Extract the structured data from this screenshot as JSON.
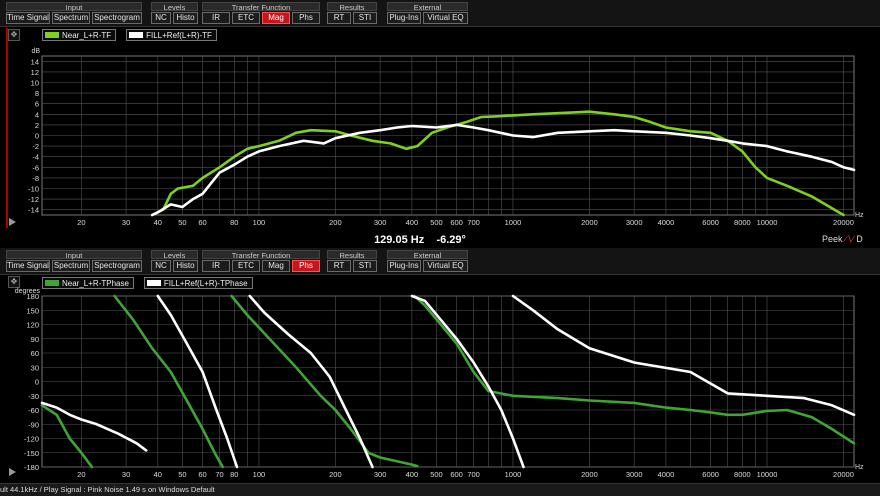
{
  "toolbar": {
    "groups": [
      {
        "title": "Input",
        "buttons": [
          "Time Signal",
          "Spectrum",
          "Spectrogram"
        ]
      },
      {
        "title": "Levels",
        "buttons": [
          "NC",
          "Histo"
        ]
      },
      {
        "title": "Transfer Function",
        "buttons": [
          "IR",
          "ETC",
          "Mag",
          "Phs"
        ]
      },
      {
        "title": "Results",
        "buttons": [
          "RT",
          "STI"
        ]
      },
      {
        "title": "External",
        "buttons": [
          "Plug-Ins",
          "Virtual EQ"
        ]
      }
    ],
    "top_active": "Mag",
    "bottom_active": "Phs"
  },
  "top_panel": {
    "legend": [
      {
        "label": "Near_L+R-TF",
        "color": "#7fd11b"
      },
      {
        "label": "FILL+Ref(L+R)-TF",
        "color": "#ffffff"
      }
    ]
  },
  "bottom_panel": {
    "legend": [
      {
        "label": "Near_L+R-TPhase",
        "color": "#3fa535"
      },
      {
        "label": "FILL+Ref(L+R)-TPhase",
        "color": "#ffffff"
      }
    ]
  },
  "readout": {
    "freq": "129.05 Hz",
    "value": "-6.29°"
  },
  "peek_label": "Peek",
  "peek_suffix": "D",
  "status_text": "ult 44.1kHz / Play Signal : Pink Noise  1.49 s on Windows Default",
  "chart_data": [
    {
      "type": "line",
      "title": "",
      "xlabel": "Hz",
      "ylabel": "dB",
      "xscale": "log",
      "xlim": [
        14,
        22000
      ],
      "ylim": [
        -15,
        15
      ],
      "x_ticks": [
        20,
        30,
        40,
        50,
        60,
        80,
        100,
        200,
        300,
        400,
        500,
        600,
        700,
        1000,
        2000,
        3000,
        4000,
        6000,
        8000,
        10000,
        20000
      ],
      "y_ticks": [
        14,
        12,
        10,
        8,
        6,
        4,
        2,
        0,
        -2,
        -4,
        -6,
        -8,
        -10,
        -12,
        -14
      ],
      "grid": true,
      "series": [
        {
          "name": "Near_L+R-TF",
          "color": "#7fd11b",
          "points": [
            [
              38,
              -15
            ],
            [
              42,
              -14
            ],
            [
              45,
              -11
            ],
            [
              48,
              -10
            ],
            [
              55,
              -9.5
            ],
            [
              60,
              -8
            ],
            [
              70,
              -6
            ],
            [
              80,
              -4
            ],
            [
              90,
              -2.5
            ],
            [
              100,
              -2
            ],
            [
              120,
              -1
            ],
            [
              140,
              0.5
            ],
            [
              160,
              1
            ],
            [
              200,
              0.8
            ],
            [
              230,
              0
            ],
            [
              280,
              -1
            ],
            [
              330,
              -1.5
            ],
            [
              380,
              -2.5
            ],
            [
              420,
              -2
            ],
            [
              480,
              0.5
            ],
            [
              550,
              1.5
            ],
            [
              650,
              2.5
            ],
            [
              750,
              3.5
            ],
            [
              850,
              3.6
            ],
            [
              1000,
              3.8
            ],
            [
              1200,
              4.0
            ],
            [
              1500,
              4.2
            ],
            [
              2000,
              4.5
            ],
            [
              2500,
              4.0
            ],
            [
              3000,
              3.5
            ],
            [
              3500,
              2.5
            ],
            [
              4000,
              1.5
            ],
            [
              5000,
              0.8
            ],
            [
              6000,
              0.5
            ],
            [
              7000,
              -1
            ],
            [
              8000,
              -3
            ],
            [
              9000,
              -6
            ],
            [
              10000,
              -8
            ],
            [
              12000,
              -9.5
            ],
            [
              15000,
              -11.5
            ],
            [
              20000,
              -15
            ]
          ]
        },
        {
          "name": "FILL+Ref(L+R)-TF",
          "color": "#ffffff",
          "points": [
            [
              38,
              -15
            ],
            [
              40,
              -14.5
            ],
            [
              45,
              -13
            ],
            [
              50,
              -13.5
            ],
            [
              55,
              -12
            ],
            [
              60,
              -11
            ],
            [
              70,
              -7
            ],
            [
              80,
              -5.5
            ],
            [
              90,
              -4
            ],
            [
              100,
              -3
            ],
            [
              120,
              -2
            ],
            [
              150,
              -1
            ],
            [
              180,
              -1.5
            ],
            [
              200,
              -0.5
            ],
            [
              250,
              0.5
            ],
            [
              300,
              1
            ],
            [
              350,
              1.5
            ],
            [
              400,
              1.8
            ],
            [
              500,
              1.5
            ],
            [
              600,
              2
            ],
            [
              700,
              1.5
            ],
            [
              800,
              1
            ],
            [
              1000,
              0
            ],
            [
              1200,
              -0.3
            ],
            [
              1500,
              0.5
            ],
            [
              2000,
              0.8
            ],
            [
              2500,
              1
            ],
            [
              3000,
              0.8
            ],
            [
              4000,
              0.5
            ],
            [
              5000,
              0
            ],
            [
              6000,
              -0.5
            ],
            [
              7000,
              -1
            ],
            [
              8000,
              -1.5
            ],
            [
              10000,
              -2
            ],
            [
              12000,
              -3
            ],
            [
              15000,
              -4
            ],
            [
              18000,
              -5
            ],
            [
              20000,
              -6
            ],
            [
              22000,
              -6.5
            ]
          ]
        }
      ]
    },
    {
      "type": "line",
      "title": "",
      "xlabel": "Hz",
      "ylabel": "degrees",
      "xscale": "log",
      "xlim": [
        14,
        22000
      ],
      "ylim": [
        -180,
        180
      ],
      "x_ticks": [
        20,
        30,
        40,
        50,
        60,
        70,
        80,
        100,
        200,
        300,
        400,
        500,
        600,
        700,
        1000,
        2000,
        3000,
        4000,
        6000,
        8000,
        10000,
        20000
      ],
      "y_ticks": [
        180,
        150,
        120,
        90,
        60,
        30,
        0,
        -30,
        -60,
        -90,
        -120,
        -150,
        -180
      ],
      "grid": true,
      "series": [
        {
          "name": "Near_L+R-TPhase",
          "color": "#3fa535",
          "segments": [
            [
              [
                14,
                -50
              ],
              [
                16,
                -70
              ],
              [
                18,
                -120
              ],
              [
                20,
                -150
              ],
              [
                22,
                -180
              ]
            ],
            [
              [
                27,
                180
              ],
              [
                32,
                130
              ],
              [
                38,
                70
              ],
              [
                45,
                20
              ],
              [
                52,
                -40
              ],
              [
                60,
                -100
              ],
              [
                67,
                -150
              ],
              [
                72,
                -180
              ]
            ],
            [
              [
                78,
                180
              ],
              [
                90,
                140
              ],
              [
                110,
                90
              ],
              [
                140,
                30
              ],
              [
                175,
                -30
              ],
              [
                200,
                -60
              ],
              [
                230,
                -100
              ],
              [
                270,
                -150
              ],
              [
                300,
                -160
              ],
              [
                400,
                -175
              ],
              [
                420,
                -178
              ]
            ],
            [
              [
                410,
                180
              ],
              [
                450,
                160
              ],
              [
                520,
                120
              ],
              [
                600,
                80
              ],
              [
                700,
                20
              ],
              [
                800,
                -20
              ],
              [
                1000,
                -30
              ],
              [
                1500,
                -35
              ],
              [
                2000,
                -40
              ],
              [
                3000,
                -45
              ],
              [
                4000,
                -55
              ],
              [
                5000,
                -60
              ],
              [
                6000,
                -65
              ],
              [
                7000,
                -70
              ],
              [
                8000,
                -70
              ],
              [
                10000,
                -62
              ],
              [
                12000,
                -60
              ],
              [
                15000,
                -75
              ],
              [
                18000,
                -100
              ],
              [
                22000,
                -130
              ]
            ]
          ]
        },
        {
          "name": "FILL+Ref(L+R)-TPhase",
          "color": "#ffffff",
          "segments": [
            [
              [
                14,
                -45
              ],
              [
                16,
                -55
              ],
              [
                18,
                -70
              ],
              [
                20,
                -80
              ],
              [
                23,
                -90
              ],
              [
                28,
                -110
              ],
              [
                33,
                -130
              ],
              [
                36,
                -145
              ]
            ],
            [
              [
                40,
                180
              ],
              [
                45,
                140
              ],
              [
                52,
                80
              ],
              [
                60,
                20
              ],
              [
                68,
                -60
              ],
              [
                75,
                -120
              ],
              [
                82,
                -180
              ]
            ],
            [
              [
                92,
                180
              ],
              [
                105,
                145
              ],
              [
                130,
                100
              ],
              [
                160,
                60
              ],
              [
                190,
                10
              ],
              [
                220,
                -60
              ],
              [
                250,
                -120
              ],
              [
                280,
                -180
              ]
            ],
            [
              [
                400,
                180
              ],
              [
                450,
                170
              ],
              [
                520,
                130
              ],
              [
                600,
                90
              ],
              [
                700,
                40
              ],
              [
                800,
                -10
              ],
              [
                900,
                -60
              ],
              [
                1000,
                -120
              ],
              [
                1100,
                -180
              ]
            ],
            [
              [
                1000,
                180
              ],
              [
                1200,
                150
              ],
              [
                1500,
                110
              ],
              [
                2000,
                70
              ],
              [
                3000,
                40
              ],
              [
                5000,
                20
              ],
              [
                7000,
                -25
              ],
              [
                10000,
                -30
              ],
              [
                14000,
                -35
              ],
              [
                18000,
                -50
              ],
              [
                22000,
                -70
              ]
            ]
          ]
        }
      ]
    }
  ]
}
